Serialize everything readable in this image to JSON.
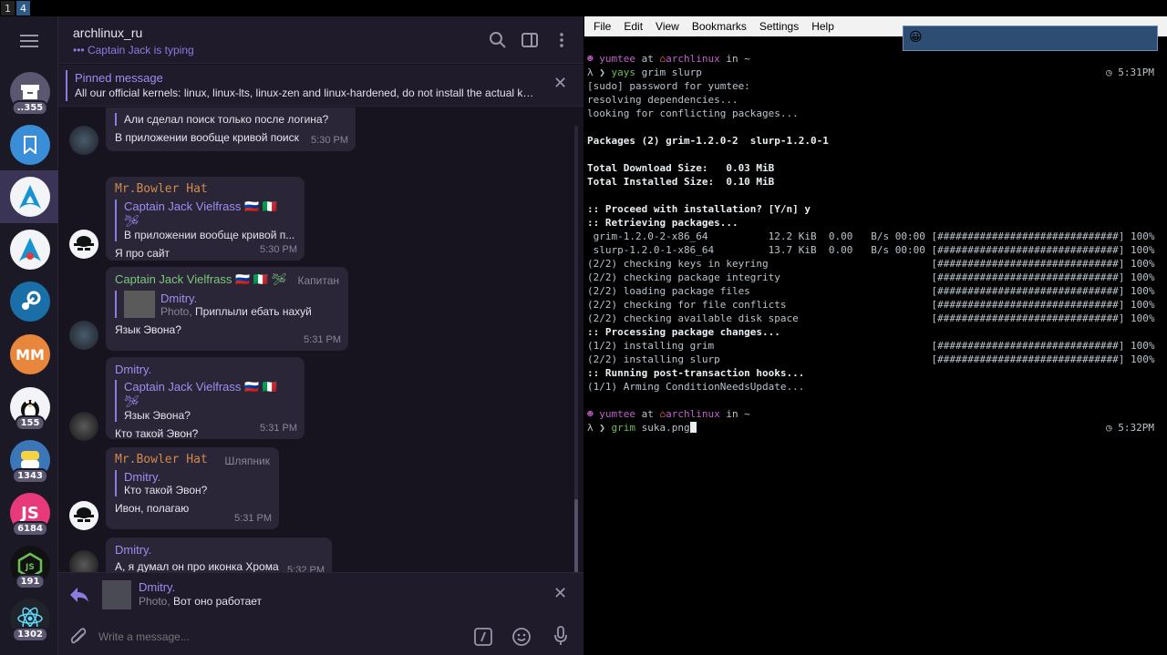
{
  "workspaces": [
    "1",
    "4"
  ],
  "telegram": {
    "rail_badges": [
      "..355",
      "155",
      "1343",
      "6184",
      "191",
      "1302"
    ],
    "rail_initials": "MM",
    "header": {
      "title": "archlinux_ru",
      "subtitle": "••• Captain Jack is typing"
    },
    "pinned": {
      "title": "Pinned message",
      "text": "All our official kernels: linux, linux-lts, linux-zen and linux-hardened, do not install the actual kernel ..."
    },
    "messages": [
      {
        "text1": "Али сделал поиск только после логина?",
        "text2": "В приложении вообще кривой поиск",
        "time": "5:30 PM"
      },
      {
        "name": "Mr.Bowler Hat",
        "reply_name": "Captain Jack Vielfrass 🇷🇺 🇮🇹 🛩",
        "reply_text": "В приложении вообще кривой п...",
        "text": "Я про сайт",
        "time": "5:30 PM"
      },
      {
        "name": "Captain Jack Vielfrass 🇷🇺 🇮🇹 🛩",
        "tag": "Капитан",
        "reply_name": "Dmitry.",
        "reply_prefix": "Photo, ",
        "reply_text": "Приплыли ебать нахуй",
        "text": "Язык Эвона?",
        "time": "5:31 PM"
      },
      {
        "name": "Dmitry.",
        "reply_name": "Captain Jack Vielfrass 🇷🇺 🇮🇹 🛩",
        "reply_text": "Язык Эвона?",
        "text": "Кто такой Эвон?",
        "time": "5:31 PM"
      },
      {
        "name": "Mr.Bowler Hat",
        "tag": "Шляпник",
        "reply_name": "Dmitry.",
        "reply_text": "Кто такой Эвон?",
        "text": "Ивон, полагаю",
        "time": "5:31 PM"
      },
      {
        "name": "Dmitry.",
        "text": "А, я думал он про иконка Хрома",
        "time": "5:32 PM"
      }
    ],
    "reply_bar": {
      "name": "Dmitry.",
      "prefix": "Photo, ",
      "text": "Вот оно работает"
    },
    "input_placeholder": "Write a message..."
  },
  "terminal": {
    "menu": [
      "File",
      "Edit",
      "View",
      "Bookmarks",
      "Settings",
      "Help"
    ],
    "prompt1": {
      "user": "yumtee",
      "at": " at ",
      "host": "archlinux",
      "in": " in ~"
    },
    "cmd1": {
      "prefix": "λ ❯ ",
      "cmd": "yays",
      "args": " grim slurp",
      "time": "5:31PM"
    },
    "lines": [
      "[sudo] password for yumtee:",
      "resolving dependencies...",
      "looking for conflicting packages...",
      "",
      "Packages (2) grim-1.2.0-2  slurp-1.2.0-1",
      "",
      "Total Download Size:   0.03 MiB",
      "Total Installed Size:  0.10 MiB",
      "",
      ":: Proceed with installation? [Y/n] y",
      ":: Retrieving packages...",
      " grim-1.2.0-2-x86_64          12.2 KiB  0.00   B/s 00:00 [##############################] 100%",
      " slurp-1.2.0-1-x86_64         13.7 KiB  0.00   B/s 00:00 [##############################] 100%",
      "(2/2) checking keys in keyring                           [##############################] 100%",
      "(2/2) checking package integrity                         [##############################] 100%",
      "(2/2) loading package files                              [##############################] 100%",
      "(2/2) checking for file conflicts                        [##############################] 100%",
      "(2/2) checking available disk space                      [##############################] 100%",
      ":: Processing package changes...",
      "(1/2) installing grim                                    [##############################] 100%",
      "(2/2) installing slurp                                   [##############################] 100%",
      ":: Running post-transaction hooks...",
      "(1/1) Arming ConditionNeedsUpdate..."
    ],
    "prompt2": {
      "user": "yumtee",
      "at": " at ",
      "host": "archlinux",
      "in": " in ~"
    },
    "cmd2": {
      "prefix": "λ ❯ ",
      "cmd": "grim",
      "args": " suka.png",
      "time": "5:32PM"
    },
    "notification_emoji": "😀"
  }
}
